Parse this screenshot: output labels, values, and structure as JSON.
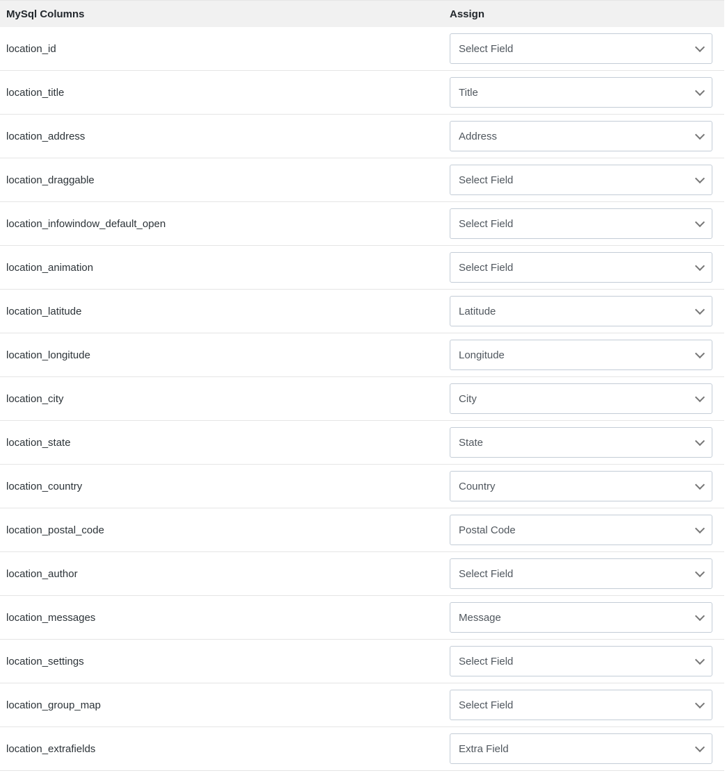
{
  "headers": {
    "columns": "MySql Columns",
    "assign": "Assign"
  },
  "rows": [
    {
      "column": "location_id",
      "assign": "Select Field"
    },
    {
      "column": "location_title",
      "assign": "Title"
    },
    {
      "column": "location_address",
      "assign": "Address"
    },
    {
      "column": "location_draggable",
      "assign": "Select Field"
    },
    {
      "column": "location_infowindow_default_open",
      "assign": "Select Field"
    },
    {
      "column": "location_animation",
      "assign": "Select Field"
    },
    {
      "column": "location_latitude",
      "assign": "Latitude"
    },
    {
      "column": "location_longitude",
      "assign": "Longitude"
    },
    {
      "column": "location_city",
      "assign": "City"
    },
    {
      "column": "location_state",
      "assign": "State"
    },
    {
      "column": "location_country",
      "assign": "Country"
    },
    {
      "column": "location_postal_code",
      "assign": "Postal Code"
    },
    {
      "column": "location_author",
      "assign": "Select Field"
    },
    {
      "column": "location_messages",
      "assign": "Message"
    },
    {
      "column": "location_settings",
      "assign": "Select Field"
    },
    {
      "column": "location_group_map",
      "assign": "Select Field"
    },
    {
      "column": "location_extrafields",
      "assign": "Extra Field"
    }
  ]
}
